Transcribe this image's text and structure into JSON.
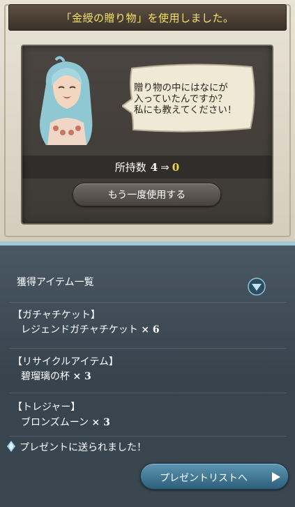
{
  "dialog": {
    "title": "「金綬の贈り物」を使用しました。",
    "speech": "贈り物の中にはなにが\n入っていたんですか？\n私にも教えてください！",
    "count_label": "所持数",
    "count_before": "4",
    "count_arrow": "⇒",
    "count_after": "0",
    "reuse_button": "もう一度使用する"
  },
  "rewards": {
    "section_title": "獲得アイテム一覧",
    "categories": [
      {
        "name": "【ガチャチケット】",
        "item": "レジェンドガチャチケット",
        "qty": "× 6"
      },
      {
        "name": "【リサイクルアイテム】",
        "item": "碧瑠璃の杯",
        "qty": "× 3"
      },
      {
        "name": "【トレジャー】",
        "item": "ブロンズムーン",
        "qty": "× 3"
      }
    ],
    "sent_notice": "プレゼントに送られました！",
    "present_button": "プレゼントリストへ"
  },
  "colors": {
    "title_text": "#f4e36a",
    "count_after": "#f2d548",
    "present_button": "#3f7c9a"
  }
}
